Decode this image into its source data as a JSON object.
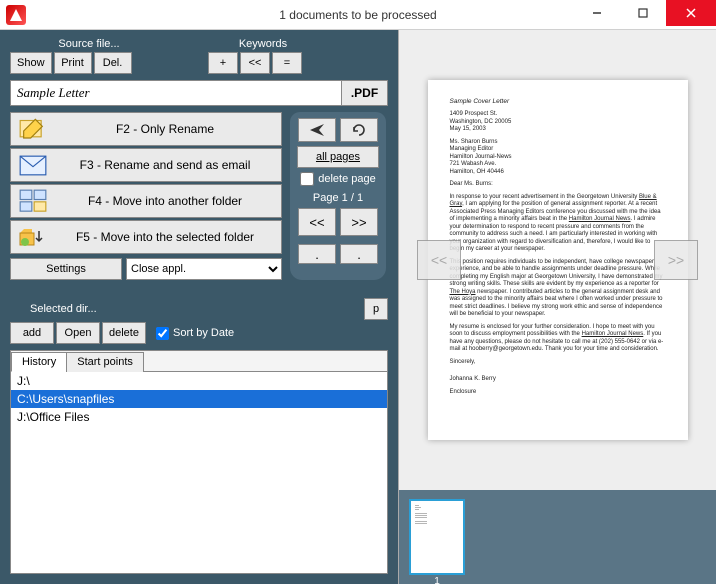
{
  "window": {
    "title": "1 documents to be processed"
  },
  "source": {
    "label": "Source file...",
    "show": "Show",
    "print": "Print",
    "del": "Del."
  },
  "keywords": {
    "label": "Keywords",
    "plus": "+",
    "back": "<<",
    "eq": "="
  },
  "filename": {
    "value": "Sample Letter",
    "ext": ".PDF"
  },
  "actions": {
    "f2": "F2 - Only Rename",
    "f3": "F3 - Rename and send as email",
    "f4": "F4 - Move into another folder",
    "f5": "F5 - Move into the selected folder"
  },
  "settings": {
    "btn": "Settings",
    "closeAppl": "Close appl."
  },
  "pagepanel": {
    "allpages": "all pages",
    "deletePage": "delete page",
    "pageLabel": "Page 1 / 1",
    "prev": "<<",
    "next": ">>",
    "dot": "."
  },
  "seldir": {
    "label": "Selected dir...",
    "p": "p",
    "add": "add",
    "open": "Open",
    "delete": "delete",
    "sort": "Sort by Date"
  },
  "tabs": {
    "history": "History",
    "startpoints": "Start points"
  },
  "historyList": [
    "J:\\",
    "C:\\Users\\snapfiles",
    "J:\\Office Files"
  ],
  "historySelectedIndex": 1,
  "thumb": {
    "num": "1"
  },
  "letter": {
    "title": "Sample Cover Letter",
    "addr1": "1409 Prospect St.",
    "addr2": "Washington, DC 20005",
    "date": "May 15, 2003",
    "to1": "Ms. Sharon Burns",
    "to2": "Managing Editor",
    "to3": "Hamilton Journal-News",
    "to4": "721 Wabash Ave.",
    "to5": "Hamilton, OH 40446",
    "salutation": "Dear Ms. Burns:",
    "p1a": "In response to your recent advertisement in the Georgetown University ",
    "p1u1": "Blue & Gray",
    "p1b": ", I am applying for the position of general assignment reporter. At a recent Associated Press Managing Editors conference you discussed with me the idea of implementing a minority affairs beat in the ",
    "p1u2": "Hamilton Journal News",
    "p1c": ". I admire your determination to respond to recent pressure and comments from the community to address such a need. I am particularly interested in working with your organization with regard to diversification and, therefore, I would like to begin my career at your newspaper.",
    "p2a": "This position requires individuals to be independent, have college newspaper experience, and be able to handle assignments under deadline pressure. While completing my English major at Georgetown University, I have demonstrated my strong writing skills. These skills are evident by my experience as a reporter for ",
    "p2u": "The Hoya",
    "p2b": " newspaper. I contributed articles to the general assignment desk and was assigned to the minority affairs beat where I often worked under pressure to meet strict deadlines. I believe my strong work ethic and sense of independence will be beneficial to your newspaper.",
    "p3a": "My resume is enclosed for your further consideration. I hope to meet with you soon to discuss employment possibilities with the ",
    "p3u": "Hamilton Journal News",
    "p3b": ". If you have any questions, please do not hesitate to call me at (202) 555-0642 or via e-mail at hooberry@georgetown.edu. Thank you for your time and consideration.",
    "closing": "Sincerely,",
    "sig": "Johanna K. Berry",
    "enc": "Enclosure"
  }
}
